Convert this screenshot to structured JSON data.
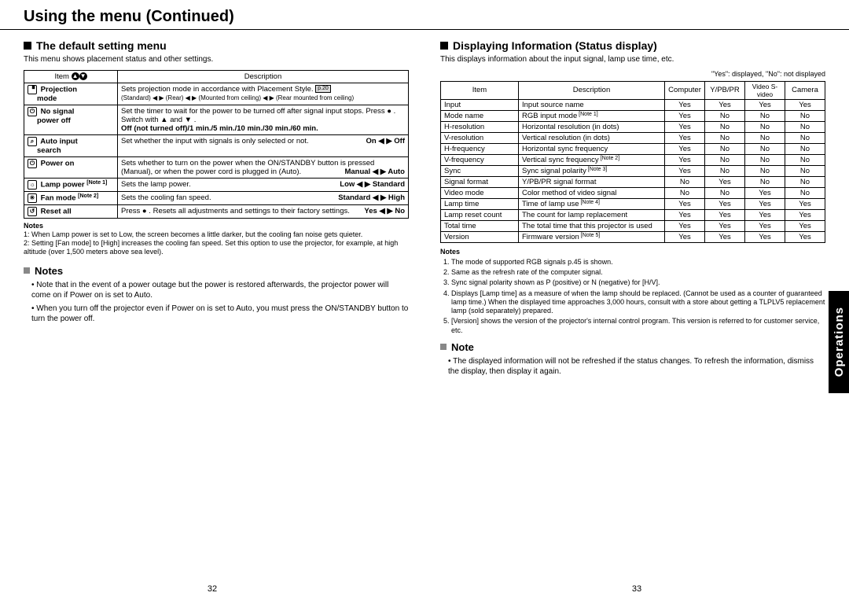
{
  "page_title": "Using the menu (Continued)",
  "side_tab": "Operations",
  "page_num_left": "32",
  "page_num_right": "33",
  "left": {
    "heading": "The default setting menu",
    "intro": "This menu shows placement status and other settings.",
    "th_item": "Item",
    "th_desc": "Description",
    "rows": [
      {
        "item1": "Projection",
        "item2": "mode",
        "desc": "Sets projection mode in accordance with Placement Style.",
        "pref": "p.20",
        "tail_html": "(Standard) ◀ ▶  (Rear) ◀ ▶  (Mounted from ceiling) ◀ ▶  (Rear mounted from ceiling)"
      },
      {
        "item1": "No signal",
        "item2": "power off",
        "desc": "Set the timer to wait for the power to be turned off after signal input stops. Press ● . Switch with ▲ and ▼ .",
        "bold_tail": "Off (not turned off)/1 min./5 min./10 min./30 min./60 min."
      },
      {
        "item1": "Auto input",
        "item2": "search",
        "desc": "Set whether the input with signals is only selected or not.",
        "right_tail": "On ◀ ▶ Off"
      },
      {
        "item1": "Power on",
        "item2": "",
        "desc": "Sets whether to turn on the power when the ON/STANDBY button is pressed (Manual), or when the power cord is plugged in (Auto).",
        "right_tail": "Manual ◀ ▶ Auto"
      },
      {
        "item1": "Lamp power",
        "note": "[Note 1]",
        "item2": "",
        "desc": "Sets the lamp power.",
        "right_tail": "Low ◀ ▶ Standard"
      },
      {
        "item1": "Fan mode",
        "note": "[Note 2]",
        "item2": "",
        "desc": "Sets the cooling fan speed.",
        "right_tail": "Standard ◀ ▶ High"
      },
      {
        "item1": "Reset all",
        "item2": "",
        "desc": "Press ● . Resets all adjustments and settings to their factory settings.",
        "right_tail": "Yes ◀ ▶ No"
      }
    ],
    "notes_label": "Notes",
    "footnote1": "1: When Lamp power is set to Low, the screen becomes a little darker, but the cooling fan noise gets quieter.",
    "footnote2": "2: Setting [Fan mode] to [High] increases the cooling fan speed. Set this option to use the projector, for example, at high altitude (over 1,500 meters above sea level).",
    "notes_heading": "Notes",
    "bullet1": "Note that in the event of a power outage but the power is restored afterwards, the projector power will come on if Power on is set to Auto.",
    "bullet2": "When you turn off the projector even if Power on is set to Auto, you must press the ON/STANDBY button to turn the power off."
  },
  "right": {
    "heading": "Displaying Information (Status display)",
    "intro": "This displays information about the input signal, lamp use time, etc.",
    "legend": "\"Yes\": displayed, \"No\": not displayed",
    "th_item": "Item",
    "th_desc": "Description",
    "th_c1": "Computer",
    "th_c2": "Y/PB/PR",
    "th_c3": "Video S-video",
    "th_c4": "Camera",
    "rows": [
      {
        "item": "Input",
        "desc": "Input source name",
        "v": [
          "Yes",
          "Yes",
          "Yes",
          "Yes"
        ]
      },
      {
        "item": "Mode name",
        "desc": "RGB input mode",
        "note": "[Note 1]",
        "v": [
          "Yes",
          "No",
          "No",
          "No"
        ]
      },
      {
        "item": "H-resolution",
        "desc": "Horizontal resolution (in dots)",
        "v": [
          "Yes",
          "No",
          "No",
          "No"
        ]
      },
      {
        "item": "V-resolution",
        "desc": "Vertical resolution (in dots)",
        "v": [
          "Yes",
          "No",
          "No",
          "No"
        ]
      },
      {
        "item": "H-frequency",
        "desc": "Horizontal sync frequency",
        "v": [
          "Yes",
          "No",
          "No",
          "No"
        ]
      },
      {
        "item": "V-frequency",
        "desc": "Vertical sync frequency",
        "note": "[Note 2]",
        "v": [
          "Yes",
          "No",
          "No",
          "No"
        ]
      },
      {
        "item": "Sync",
        "desc": "Sync signal polarity",
        "note": "[Note 3]",
        "v": [
          "Yes",
          "No",
          "No",
          "No"
        ]
      },
      {
        "item": "Signal format",
        "desc": "Y/PB/PR signal format",
        "v": [
          "No",
          "Yes",
          "No",
          "No"
        ]
      },
      {
        "item": "Video mode",
        "desc": "Color method of video signal",
        "v": [
          "No",
          "No",
          "Yes",
          "No"
        ]
      },
      {
        "item": "Lamp time",
        "desc": "Time of lamp use",
        "note": "[Note 4]",
        "v": [
          "Yes",
          "Yes",
          "Yes",
          "Yes"
        ]
      },
      {
        "item": "Lamp reset count",
        "desc": "The count for lamp replacement",
        "v": [
          "Yes",
          "Yes",
          "Yes",
          "Yes"
        ]
      },
      {
        "item": "Total time",
        "desc": "The total time that this projector is used",
        "v": [
          "Yes",
          "Yes",
          "Yes",
          "Yes"
        ]
      },
      {
        "item": "Version",
        "desc": "Firmware version",
        "note": "[Note 5]",
        "v": [
          "Yes",
          "Yes",
          "Yes",
          "Yes"
        ]
      }
    ],
    "notes_label": "Notes",
    "fn1": "The mode of supported RGB signals p.45 is shown.",
    "fn2": "Same as the refresh rate of the computer signal.",
    "fn3": "Sync signal polarity shown as P (positive) or N (negative) for [H/V].",
    "fn4": "Displays [Lamp time] as a measure of when the lamp should be replaced. (Cannot be used as a counter of guaranteed lamp time.) When the displayed time approaches 3,000 hours, consult with a store about getting a TLPLV5 replacement lamp (sold separately) prepared.",
    "fn5": "[Version] shows the version of the projector's internal control program. This version is referred to for customer service, etc.",
    "note_heading": "Note",
    "note_bullet": "The displayed information will not be refreshed if the status changes. To refresh the information, dismiss the display, then display it again."
  }
}
